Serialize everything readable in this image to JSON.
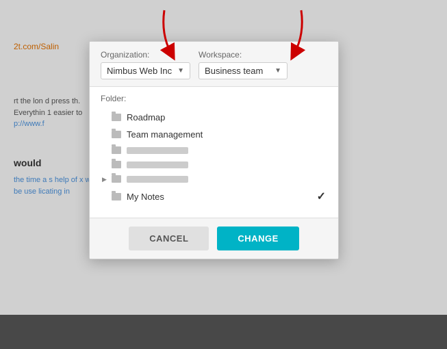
{
  "background": {
    "url_text": "2t.com/Salin",
    "url_prefix": "p://www.f",
    "para1": "rt the lon d press th. Everythin 1 easier to",
    "heading": "would",
    "para2": "the time a s help of x will be use licating in"
  },
  "arrows": {
    "left_label": "arrow-to-org",
    "right_label": "arrow-to-workspace"
  },
  "dialog": {
    "org_label": "Organization:",
    "org_value": "Nimbus Web Inc",
    "org_placeholder": "Nimbus Web Inc",
    "workspace_label": "Workspace:",
    "workspace_value": "Business team",
    "workspace_placeholder": "Business team",
    "folder_label": "Folder:",
    "folders": [
      {
        "id": "roadmap",
        "name": "Roadmap",
        "blurred": false,
        "expandable": false,
        "checked": false
      },
      {
        "id": "team-management",
        "name": "Team management",
        "blurred": false,
        "expandable": false,
        "checked": false
      },
      {
        "id": "blurred1",
        "name": "",
        "blurred": true,
        "expandable": false,
        "checked": false
      },
      {
        "id": "blurred2",
        "name": "",
        "blurred": true,
        "expandable": false,
        "checked": false
      },
      {
        "id": "blurred3",
        "name": "",
        "blurred": true,
        "expandable": true,
        "checked": false
      },
      {
        "id": "my-notes",
        "name": "My Notes",
        "blurred": false,
        "expandable": false,
        "checked": true
      }
    ],
    "cancel_label": "CANCEL",
    "change_label": "CHANGE"
  }
}
